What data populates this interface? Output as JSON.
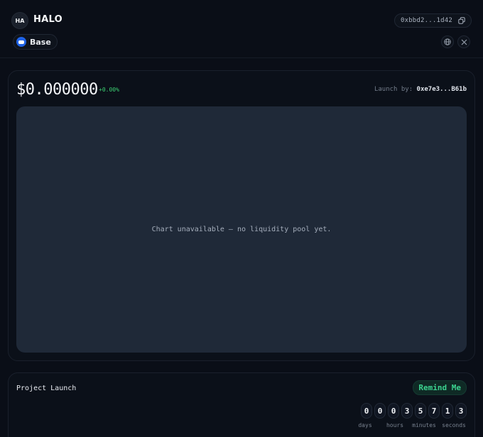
{
  "header": {
    "avatar_initials": "HA",
    "token_name": "HALO",
    "chain": {
      "label": "Base",
      "icon": "base-chain-icon",
      "color": "#1f62e6"
    },
    "contract_address": "0xbbd2...1d42",
    "copy_icon": "copy-icon",
    "website_icon": "globe-icon",
    "social_icon": "x-icon"
  },
  "price_panel": {
    "price": "$0.000000",
    "change": "+0.00%",
    "launch_by_label": "Launch by:",
    "launch_by_address": "0xe7e3...B61b",
    "chart_message": "Chart unavailable — no liquidity pool yet."
  },
  "launch": {
    "title": "Project Launch",
    "remind_button": "Remind Me",
    "digits": [
      "0",
      "0",
      "0",
      "3",
      "5",
      "7",
      "1",
      "3"
    ],
    "units": [
      "days",
      "hours",
      "minutes",
      "seconds"
    ]
  },
  "colors": {
    "background": "#0a0e17",
    "card": "#0b1019",
    "chart_area": "#1f2938",
    "positive": "#3ccf72",
    "accent": "#3bd28f"
  }
}
